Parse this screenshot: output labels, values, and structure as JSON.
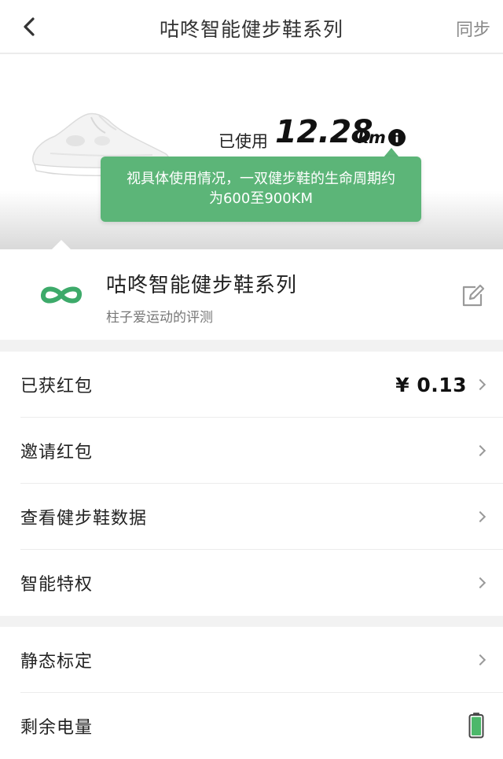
{
  "header": {
    "back_icon": "chevron-left-icon",
    "title": "咕咚智能健步鞋系列",
    "sync_label": "同步"
  },
  "usage": {
    "label": "已使用",
    "value": "12.28",
    "unit": "km",
    "info_icon": "info-icon",
    "tooltip": "视具体使用情况，一双健步鞋的生命周期约\n为600至900KM",
    "tooltip_color": "#5cb578"
  },
  "series": {
    "name": "咕咚智能健步鞋系列",
    "subtitle": "柱子爱运动的评测",
    "logo_icon": "infinity-logo-icon",
    "edit_icon": "edit-icon",
    "brand_color": "#3daa6a"
  },
  "menu_group_1": {
    "items": [
      {
        "label": "已获红包",
        "value": "¥ 0.13"
      },
      {
        "label": "邀请红包"
      },
      {
        "label": "查看健步鞋数据"
      },
      {
        "label": "智能特权"
      }
    ]
  },
  "menu_group_2": {
    "items": [
      {
        "label": "静态标定"
      },
      {
        "label": "剩余电量"
      }
    ],
    "battery_level": 1.0,
    "battery_color": "#4cb86a"
  }
}
